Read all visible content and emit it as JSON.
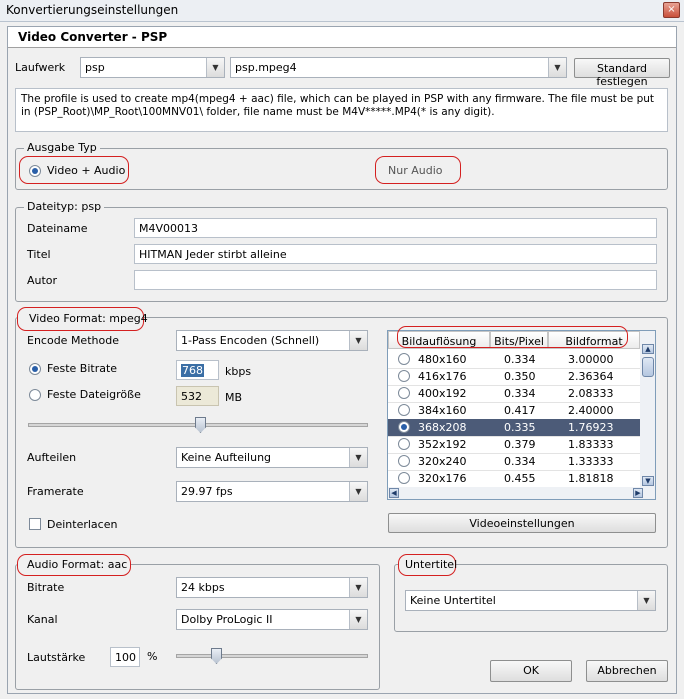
{
  "window": {
    "title": "Konvertierungseinstellungen",
    "close": "×"
  },
  "header": {
    "title": "Video Converter - PSP"
  },
  "device": {
    "label": "Laufwerk",
    "drive_value": "psp",
    "profile_value": "psp.mpeg4",
    "default_button": "Standard festlegen",
    "description": "The profile is used to create mp4(mpeg4 + aac) file, which can be played in PSP with any firmware. The file must be put in (PSP_Root)\\MP_Root\\100MNV01\\ folder, file name must be M4V*****.MP4(* is any digit)."
  },
  "output_type": {
    "legend": "Ausgabe Typ",
    "video_audio": "Video + Audio",
    "audio_only": "Nur Audio"
  },
  "filetype": {
    "legend": "Dateityp: psp",
    "filename_label": "Dateiname",
    "filename_value": "M4V00013",
    "title_label": "Titel",
    "title_value": "HITMAN Jeder stirbt alleine",
    "author_label": "Autor",
    "author_value": ""
  },
  "video": {
    "legend": "Video Format: mpeg4",
    "encode_label": "Encode Methode",
    "encode_value": "1-Pass Encoden (Schnell)",
    "fixed_bitrate_label": "Feste Bitrate",
    "bitrate_value": "768",
    "bitrate_unit": "kbps",
    "fixed_size_label": "Feste Dateigröße",
    "size_value": "532",
    "size_unit": "MB",
    "split_label": "Aufteilen",
    "split_value": "Keine Aufteilung",
    "framerate_label": "Framerate",
    "framerate_value": "29.97 fps",
    "deinterlace_label": "Deinterlacen",
    "video_settings_button": "Videoeinstellungen",
    "columns": [
      "Bildauflösung",
      "Bits/Pixel",
      "Bildformat"
    ],
    "rows": [
      {
        "res": "480x160",
        "bpp": "0.334",
        "ratio": "3.00000"
      },
      {
        "res": "416x176",
        "bpp": "0.350",
        "ratio": "2.36364"
      },
      {
        "res": "400x192",
        "bpp": "0.334",
        "ratio": "2.08333"
      },
      {
        "res": "384x160",
        "bpp": "0.417",
        "ratio": "2.40000"
      },
      {
        "res": "368x208",
        "bpp": "0.335",
        "ratio": "1.76923"
      },
      {
        "res": "352x192",
        "bpp": "0.379",
        "ratio": "1.83333"
      },
      {
        "res": "320x240",
        "bpp": "0.334",
        "ratio": "1.33333"
      },
      {
        "res": "320x176",
        "bpp": "0.455",
        "ratio": "1.81818"
      }
    ],
    "selected_row": 4
  },
  "audio": {
    "legend": "Audio Format: aac",
    "bitrate_label": "Bitrate",
    "bitrate_value": "24 kbps",
    "channel_label": "Kanal",
    "channel_value": "Dolby ProLogic II",
    "volume_label": "Lautstärke",
    "volume_value": "100",
    "volume_unit": "%"
  },
  "subtitle": {
    "legend": "Untertitel",
    "value": "Keine Untertitel"
  },
  "buttons": {
    "ok": "OK",
    "cancel": "Abbrechen"
  },
  "colors": {
    "highlight_red": "#d42020",
    "selected_row": "#4c5b78"
  }
}
